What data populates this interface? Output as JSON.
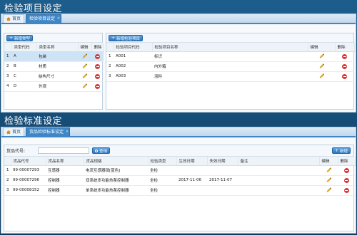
{
  "section1_title": "检验项目设定",
  "section2_title": "检验标准设定",
  "panel1": {
    "tabs": {
      "home": "首页",
      "active": "检验项目设定",
      "close": "×"
    },
    "left": {
      "add_button": "新增类型",
      "columns": [
        "",
        "类型代码",
        "类型名称",
        "编辑",
        "删除"
      ],
      "rows": [
        {
          "n": "1",
          "code": "A",
          "name": "包装",
          "selected": true
        },
        {
          "n": "2",
          "code": "B",
          "name": "材质",
          "selected": false
        },
        {
          "n": "3",
          "code": "C",
          "name": "结构尺寸",
          "selected": false
        },
        {
          "n": "4",
          "code": "D",
          "name": "外观",
          "selected": false
        }
      ]
    },
    "right": {
      "add_button": "新增检验项目",
      "columns": [
        "",
        "检验项目代码",
        "检验项目名称",
        "编辑",
        "删除"
      ],
      "rows": [
        {
          "n": "1",
          "code": "A001",
          "name": "标识"
        },
        {
          "n": "2",
          "code": "A002",
          "name": "内外箱"
        },
        {
          "n": "3",
          "code": "A003",
          "name": "泡料"
        }
      ]
    }
  },
  "panel2": {
    "tabs": {
      "home": "首页",
      "active": "货品检验标准设定",
      "close": "×"
    },
    "search": {
      "label": "货品代号:",
      "value": "",
      "button": "查询"
    },
    "add_button": "新增",
    "columns": [
      "",
      "货品代号",
      "货品名称",
      "货品规格",
      "检验类型",
      "生效日期",
      "失效日期",
      "备注",
      "编辑",
      "删除"
    ],
    "rows": [
      {
        "n": "1",
        "code": "99-00007293",
        "name": "互感器",
        "spec": "电流互感器锁[蓝色]",
        "type": "全检",
        "start": "",
        "end": "",
        "note": ""
      },
      {
        "n": "2",
        "code": "99-00007296",
        "name": "控制器",
        "spec": "双系统多功能热泵控制器",
        "type": "全检",
        "start": "2017-11-06",
        "end": "2017-11-07",
        "note": ""
      },
      {
        "n": "3",
        "code": "99-00008152",
        "name": "控制器",
        "spec": "单系统多功能热泵控制器",
        "type": "全检",
        "start": "",
        "end": "",
        "note": ""
      }
    ]
  }
}
